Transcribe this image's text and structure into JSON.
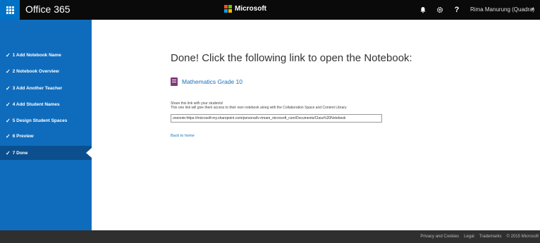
{
  "topbar": {
    "app_name": "Office 365",
    "brand": "Microsoft",
    "user": "Rima Manurung (Quadra)",
    "icons": [
      "waffle-icon",
      "bell-icon",
      "gear-icon",
      "help-icon",
      "chevron-down-icon"
    ],
    "help_glyph": "?",
    "accent": "#0072c6",
    "logo_colors": [
      "#f25022",
      "#7fba00",
      "#00a4ef",
      "#ffb900"
    ]
  },
  "sidebar": {
    "color": "#0f6cbd",
    "active_color": "#0b4f8f",
    "steps": [
      {
        "label": "1 Add Notebook Name",
        "done": true
      },
      {
        "label": "2 Notebook Overview",
        "done": true
      },
      {
        "label": "3 Add Another Teacher",
        "done": true
      },
      {
        "label": "4 Add Student Names",
        "done": true
      },
      {
        "label": "5 Design Student Spaces",
        "done": true
      },
      {
        "label": "6 Preview",
        "done": true
      },
      {
        "label": "7 Done",
        "done": true,
        "active": true
      }
    ]
  },
  "main": {
    "heading": "Done! Click the following link to open the Notebook:",
    "notebook_link": "Mathematics Grade 10",
    "notebook_color": "#80397b",
    "share_line1": "Share this link with your students!",
    "share_line2": "This one link will give them access to their own notebook along with the Collaboration Space and Content Library",
    "url": "onenote:https://microsoft-my.sharepoint.com/personal/v-rimam_microsoft_com/Documents/Class%20Notebook",
    "back_link": "Back to home"
  },
  "footer": {
    "links": [
      "Privacy and Cookies",
      "Legal",
      "Trademarks",
      "© 2015 Microsoft"
    ]
  }
}
